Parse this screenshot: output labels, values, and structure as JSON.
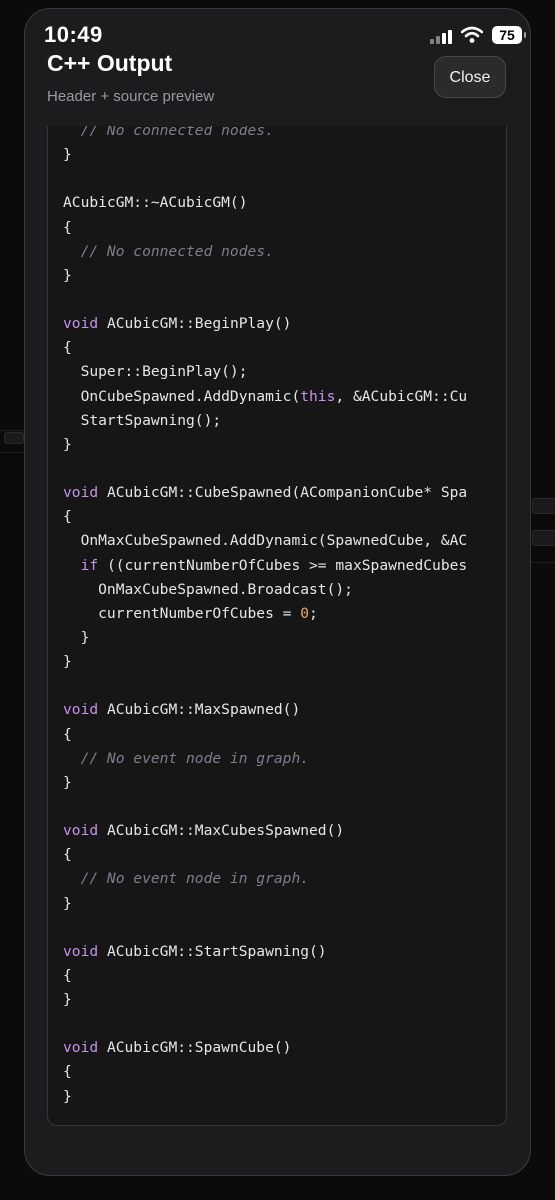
{
  "status_bar": {
    "time": "10:49",
    "battery": "75"
  },
  "header": {
    "title": "C++ Output",
    "subtitle": "Header + source preview",
    "close_label": "Close"
  },
  "code_lines": [
    [
      [
        "cm",
        "  // No connected nodes."
      ]
    ],
    [
      [
        "t",
        "}"
      ]
    ],
    [],
    [
      [
        "t",
        "ACubicGM::~ACubicGM()"
      ]
    ],
    [
      [
        "t",
        "{"
      ]
    ],
    [
      [
        "cm",
        "  // No connected nodes."
      ]
    ],
    [
      [
        "t",
        "}"
      ]
    ],
    [],
    [
      [
        "kw",
        "void"
      ],
      [
        "t",
        " ACubicGM::BeginPlay()"
      ]
    ],
    [
      [
        "t",
        "{"
      ]
    ],
    [
      [
        "t",
        "  Super::BeginPlay();"
      ]
    ],
    [
      [
        "t",
        "  OnCubeSpawned.AddDynamic("
      ],
      [
        "kw",
        "this"
      ],
      [
        "t",
        ", &ACubicGM::Cu"
      ]
    ],
    [
      [
        "t",
        "  StartSpawning();"
      ]
    ],
    [
      [
        "t",
        "}"
      ]
    ],
    [],
    [
      [
        "kw",
        "void"
      ],
      [
        "t",
        " ACubicGM::CubeSpawned(ACompanionCube* Spa"
      ]
    ],
    [
      [
        "t",
        "{"
      ]
    ],
    [
      [
        "t",
        "  OnMaxCubeSpawned.AddDynamic(SpawnedCube, &AC"
      ]
    ],
    [
      [
        "t",
        "  "
      ],
      [
        "kw",
        "if"
      ],
      [
        "t",
        " ((currentNumberOfCubes >= maxSpawnedCubes"
      ]
    ],
    [
      [
        "t",
        "    OnMaxCubeSpawned.Broadcast();"
      ]
    ],
    [
      [
        "t",
        "    currentNumberOfCubes = "
      ],
      [
        "num",
        "0"
      ],
      [
        "t",
        ";"
      ]
    ],
    [
      [
        "t",
        "  }"
      ]
    ],
    [
      [
        "t",
        "}"
      ]
    ],
    [],
    [
      [
        "kw",
        "void"
      ],
      [
        "t",
        " ACubicGM::MaxSpawned()"
      ]
    ],
    [
      [
        "t",
        "{"
      ]
    ],
    [
      [
        "cm",
        "  // No event node in graph."
      ]
    ],
    [
      [
        "t",
        "}"
      ]
    ],
    [],
    [
      [
        "kw",
        "void"
      ],
      [
        "t",
        " ACubicGM::MaxCubesSpawned()"
      ]
    ],
    [
      [
        "t",
        "{"
      ]
    ],
    [
      [
        "cm",
        "  // No event node in graph."
      ]
    ],
    [
      [
        "t",
        "}"
      ]
    ],
    [],
    [
      [
        "kw",
        "void"
      ],
      [
        "t",
        " ACubicGM::StartSpawning()"
      ]
    ],
    [
      [
        "t",
        "{"
      ]
    ],
    [
      [
        "t",
        "}"
      ]
    ],
    [],
    [
      [
        "kw",
        "void"
      ],
      [
        "t",
        " ACubicGM::SpawnCube()"
      ]
    ],
    [
      [
        "t",
        "{"
      ]
    ],
    [
      [
        "t",
        "}"
      ]
    ]
  ]
}
